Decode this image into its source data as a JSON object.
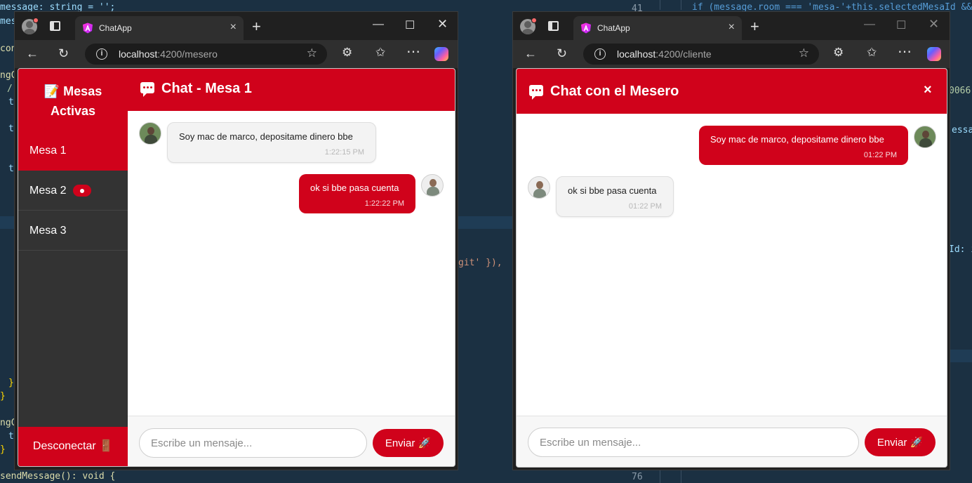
{
  "editor": {
    "left_lines": [
      "message: string = '';",
      "mes",
      "con",
      "ngC",
      "/",
      "t",
      "t",
      "t",
      "}",
      "}",
      "ngC",
      "t",
      "}",
      "sendMessage(): void {"
    ],
    "right_lines": [
      "if (message.room === 'mesa-'+this.selectedMesaId &&",
      "0066.",
      "essa",
      "Id: i",
      "git' }),"
    ],
    "gutter_top": "41",
    "gutter_bottom": "76"
  },
  "waiter_window": {
    "tab_title": "ChatApp",
    "url_host": "localhost",
    "url_rest": ":4200/mesero",
    "sidebar": {
      "title_line1": "📝 Mesas",
      "title_line2": "Activas",
      "items": [
        {
          "label": "Mesa 1",
          "active": true,
          "unread": false
        },
        {
          "label": "Mesa 2",
          "active": false,
          "unread": true
        },
        {
          "label": "Mesa 3",
          "active": false,
          "unread": false
        }
      ],
      "logout_label": "Desconectar 🚪"
    },
    "chat_title": "Chat - Mesa 1",
    "messages": [
      {
        "text": "Soy mac de marco, depositame dinero bbe",
        "time": "1:22:15 PM",
        "direction": "in"
      },
      {
        "text": "ok si bbe pasa cuenta",
        "time": "1:22:22 PM",
        "direction": "out"
      }
    ],
    "input_placeholder": "Escribe un mensaje...",
    "send_label": "Enviar 🚀"
  },
  "client_window": {
    "tab_title": "ChatApp",
    "url_host": "localhost",
    "url_rest": ":4200/cliente",
    "chat_title": "Chat con el Mesero",
    "close_label": "×",
    "messages": [
      {
        "text": "Soy mac de marco, depositame dinero bbe",
        "time": "01:22 PM",
        "direction": "out"
      },
      {
        "text": "ok si bbe pasa cuenta",
        "time": "01:22 PM",
        "direction": "in"
      }
    ],
    "input_placeholder": "Escribe un mensaje...",
    "send_label": "Enviar 🚀"
  },
  "colors": {
    "accent_red": "#d0021b",
    "sidebar_dark": "#333333",
    "editor_bg": "#1b3042"
  }
}
